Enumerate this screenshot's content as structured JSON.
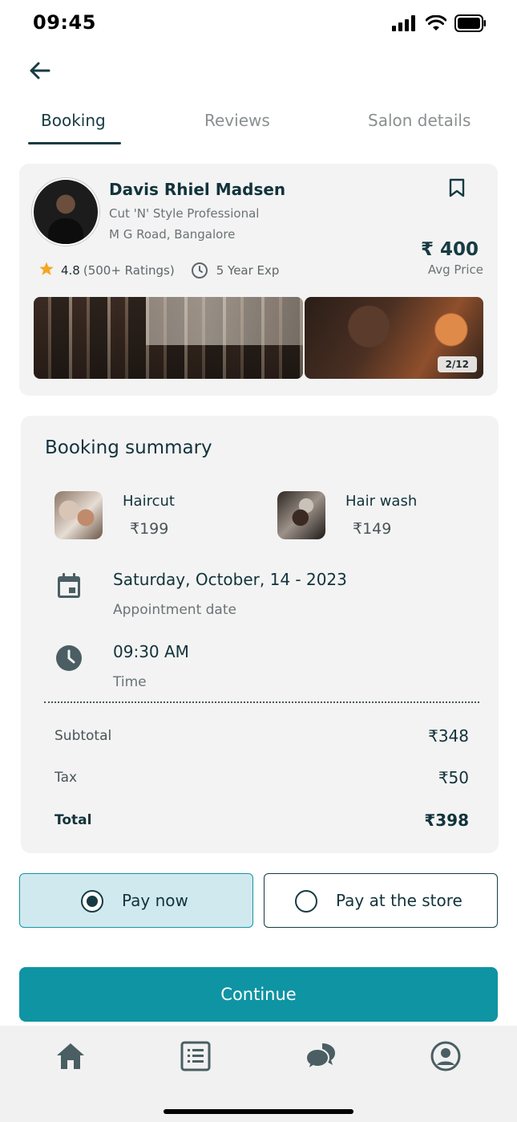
{
  "status_bar": {
    "time": "09:45"
  },
  "tabs": [
    {
      "label": "Booking",
      "active": true
    },
    {
      "label": "Reviews",
      "active": false
    },
    {
      "label": "Salon details",
      "active": false
    }
  ],
  "profile": {
    "name": "Davis Rhiel Madsen",
    "title": "Cut 'N' Style Professional",
    "location": "M G Road, Bangalore",
    "rating": "4.8",
    "ratings_count": "(500+ Ratings)",
    "experience": "5 Year Exp",
    "price": "₹ 400",
    "price_caption": "Avg Price",
    "gallery_counter": "2/12"
  },
  "summary": {
    "title": "Booking summary",
    "services": [
      {
        "name": "Haircut",
        "price": "₹199"
      },
      {
        "name": "Hair wash",
        "price": "₹149"
      }
    ],
    "date": {
      "value": "Saturday, October, 14 - 2023",
      "label": "Appointment date"
    },
    "time": {
      "value": "09:30 AM",
      "label": "Time"
    },
    "subtotal": {
      "label": "Subtotal",
      "amount": "₹348"
    },
    "tax": {
      "label": "Tax",
      "amount": "₹50"
    },
    "total": {
      "label": "Total",
      "amount": "₹398"
    }
  },
  "payment": {
    "options": [
      {
        "label": "Pay now",
        "selected": true
      },
      {
        "label": "Pay at the store",
        "selected": false
      }
    ]
  },
  "continue_label": "Continue",
  "colors": {
    "primary": "#0f94a3",
    "dark_teal": "#163b43",
    "selected_bg": "#d0e9ef",
    "card_bg": "#f3f3f3",
    "star": "#f5a623"
  },
  "bottom_nav": {
    "items": [
      {
        "icon": "home-icon"
      },
      {
        "icon": "list-icon"
      },
      {
        "icon": "chat-icon"
      },
      {
        "icon": "profile-icon"
      }
    ]
  }
}
